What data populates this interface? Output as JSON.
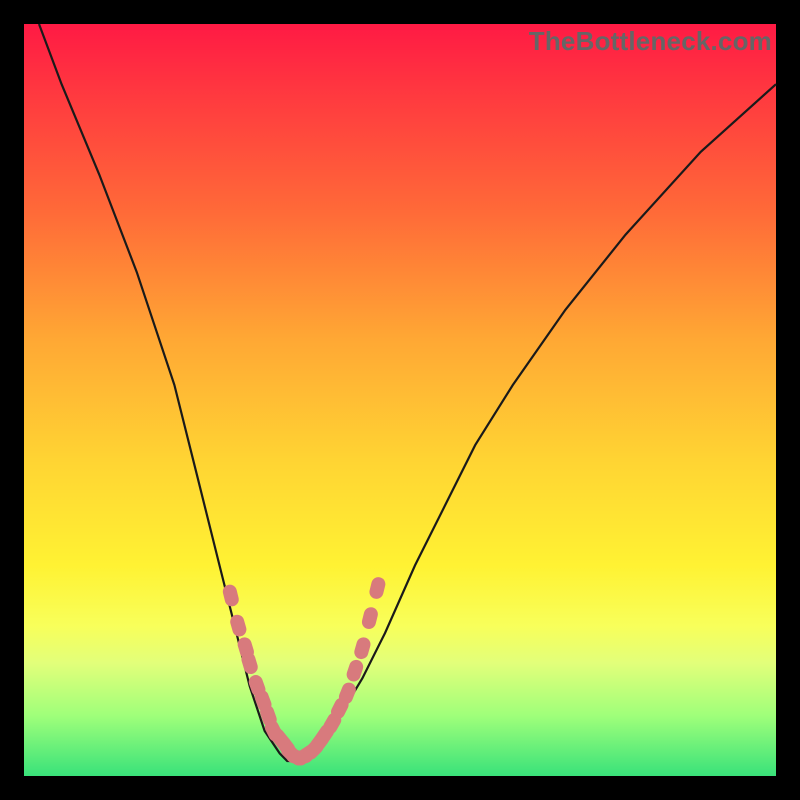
{
  "watermark_text": "TheBottleneck.com",
  "colors": {
    "background_black": "#000000",
    "marker": "#d87a7d",
    "curve": "#1a1a1a",
    "gradient_top": "#ff1a44",
    "gradient_bottom": "#39e27a"
  },
  "chart_data": {
    "type": "line",
    "title": "",
    "xlabel": "",
    "ylabel": "",
    "xlim": [
      0,
      100
    ],
    "ylim": [
      0,
      100
    ],
    "series": [
      {
        "name": "bottleneck-curve",
        "x": [
          2,
          5,
          10,
          15,
          20,
          23,
          26,
          28,
          30,
          32,
          34,
          35,
          36,
          37,
          38,
          40,
          42,
          45,
          48,
          52,
          56,
          60,
          65,
          72,
          80,
          90,
          100
        ],
        "values": [
          100,
          92,
          80,
          67,
          52,
          40,
          28,
          20,
          12,
          6,
          3,
          2,
          2,
          2,
          3,
          5,
          8,
          13,
          19,
          28,
          36,
          44,
          52,
          62,
          72,
          83,
          92
        ]
      }
    ],
    "markers": {
      "name": "highlighted-points",
      "x": [
        27.5,
        28.5,
        29.5,
        30.0,
        31.0,
        31.8,
        32.5,
        33.2,
        34.0,
        34.8,
        35.5,
        36.3,
        37.0,
        37.8,
        38.5,
        39.3,
        40.0,
        41.0,
        42.0,
        43.0,
        44.0,
        45.0,
        46.0,
        47.0
      ],
      "y": [
        24,
        20,
        17,
        15,
        12,
        10,
        8,
        6,
        5,
        4,
        3,
        2.5,
        2.5,
        3,
        3.5,
        4.5,
        5.5,
        7,
        9,
        11,
        14,
        17,
        21,
        25
      ]
    }
  }
}
